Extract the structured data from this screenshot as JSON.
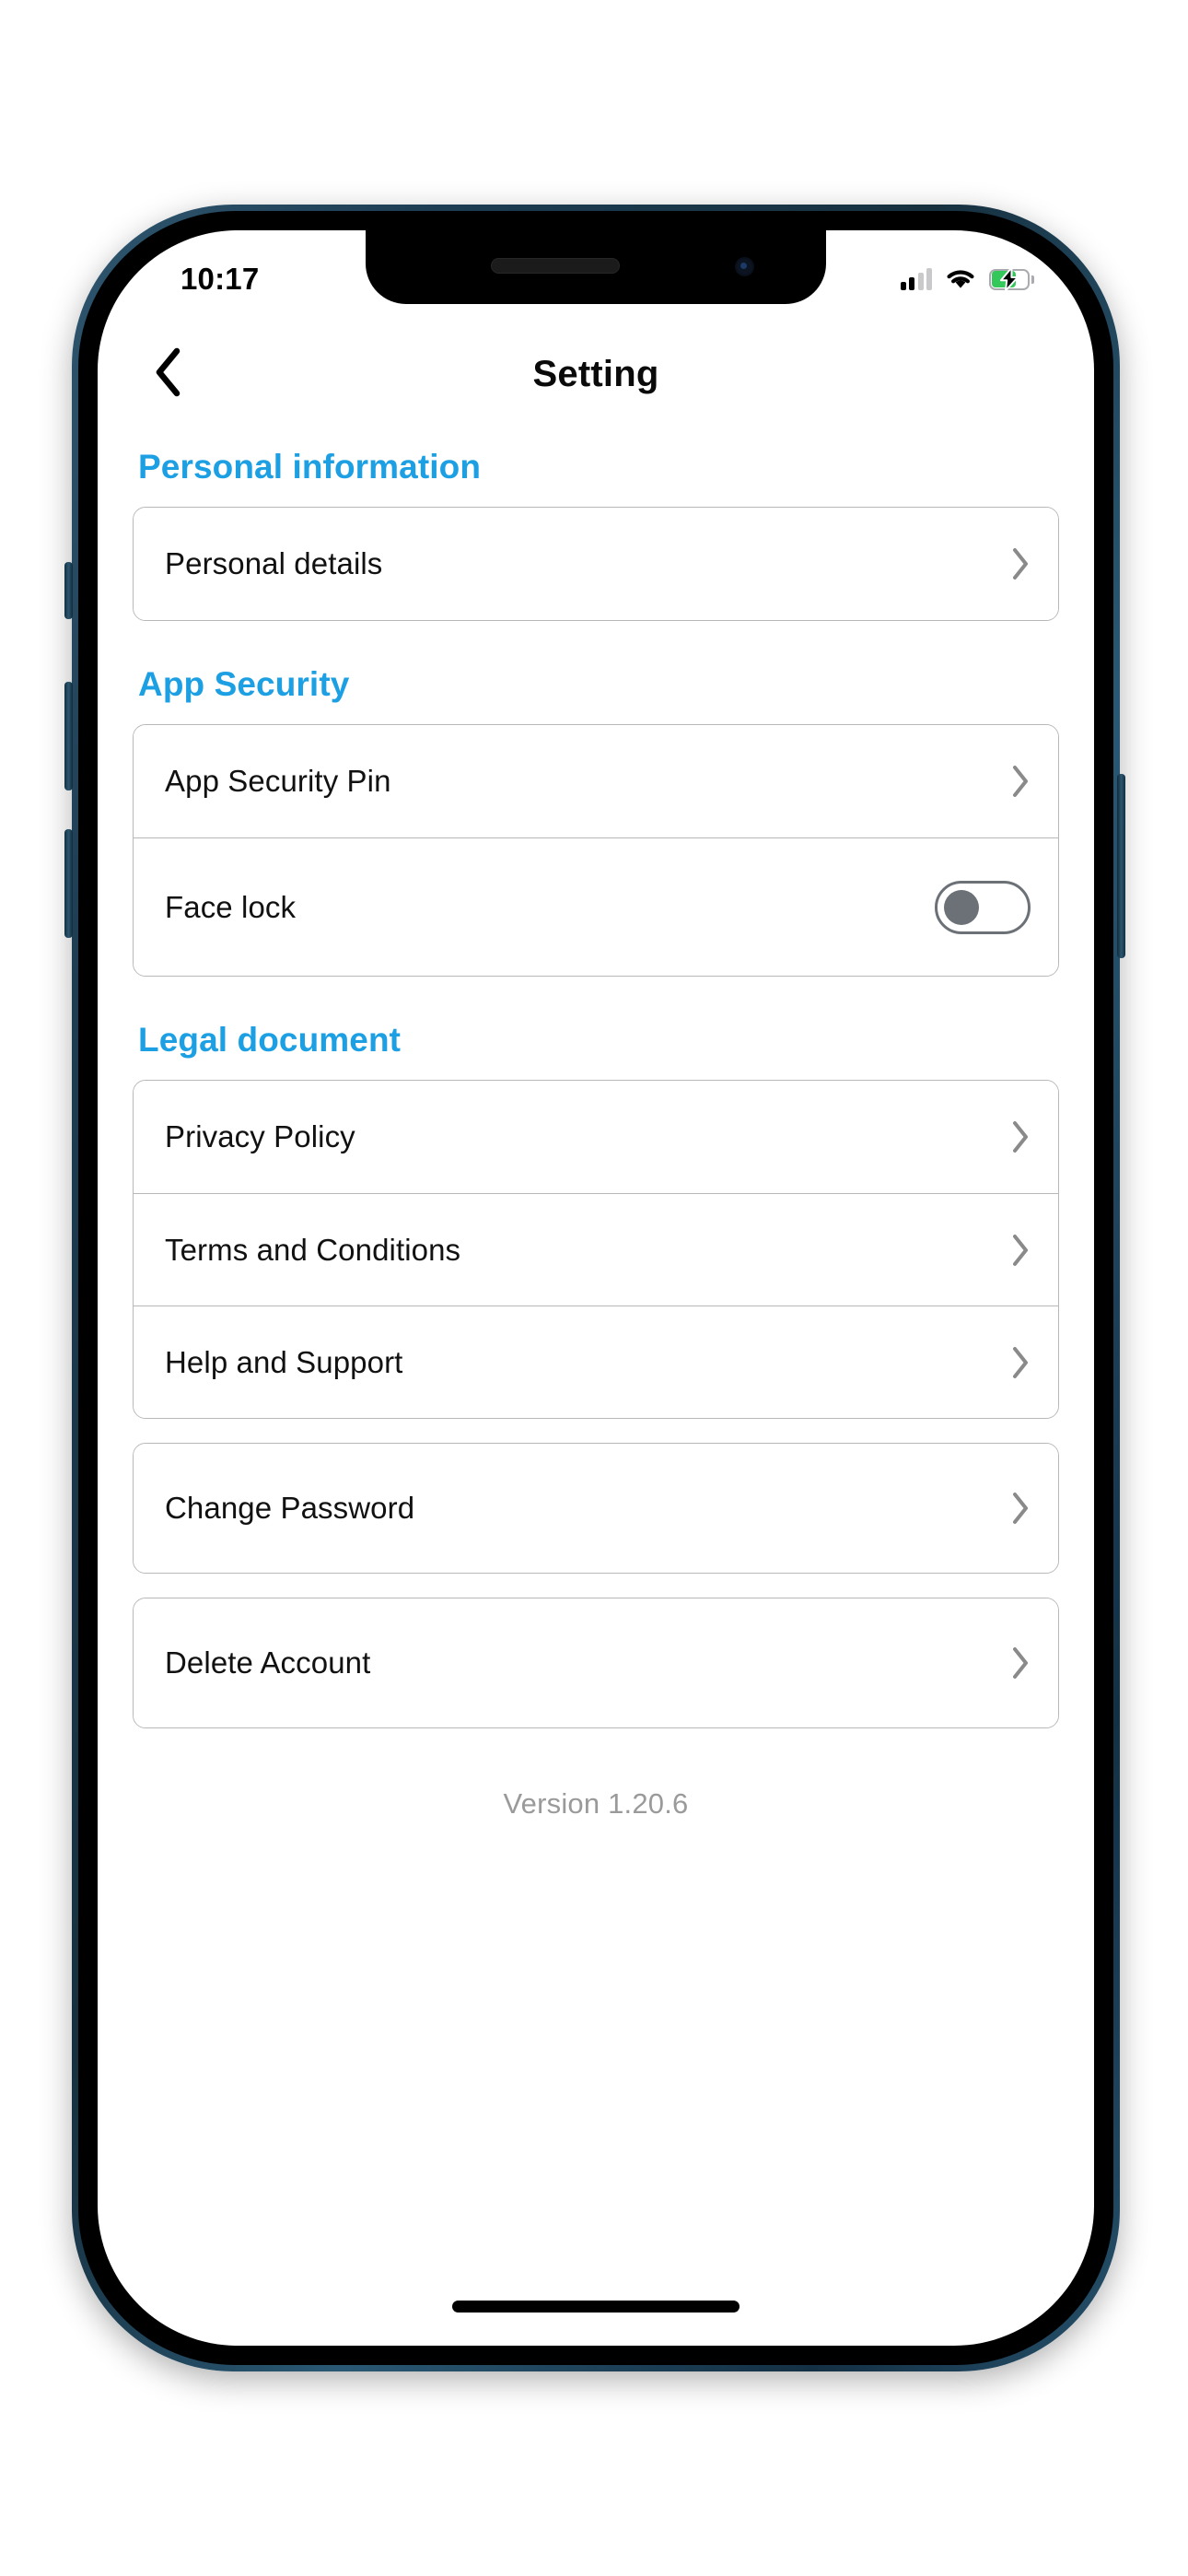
{
  "status_bar": {
    "time": "10:17",
    "signal_icon": "cellular-signal-icon",
    "signal_bars_filled": 2,
    "signal_bars_total": 4,
    "wifi_icon": "wifi-icon",
    "battery_icon": "battery-charging-icon",
    "battery_level_percent": 60,
    "battery_color": "#34c759",
    "charging": true
  },
  "header": {
    "back_icon": "chevron-left-icon",
    "title": "Setting"
  },
  "theme": {
    "accent": "#1CA0E3",
    "text": "#111111",
    "muted": "#9a9a9a",
    "border": "#b8b8b8",
    "background": "#ffffff"
  },
  "sections": [
    {
      "title": "Personal information",
      "cards": [
        {
          "rows": [
            {
              "label": "Personal details",
              "control": "chevron",
              "icon": "chevron-right-icon"
            }
          ]
        }
      ]
    },
    {
      "title": "App Security",
      "cards": [
        {
          "rows": [
            {
              "label": "App Security Pin",
              "control": "chevron",
              "icon": "chevron-right-icon"
            },
            {
              "label": "Face lock",
              "control": "toggle",
              "icon": "toggle-switch-icon",
              "value": "off"
            }
          ]
        }
      ]
    },
    {
      "title": "Legal document",
      "cards": [
        {
          "rows": [
            {
              "label": "Privacy Policy",
              "control": "chevron",
              "icon": "chevron-right-icon"
            },
            {
              "label": "Terms and Conditions",
              "control": "chevron",
              "icon": "chevron-right-icon"
            },
            {
              "label": "Help and Support",
              "control": "chevron",
              "icon": "chevron-right-icon"
            }
          ]
        },
        {
          "rows": [
            {
              "label": "Change Password",
              "control": "chevron",
              "icon": "chevron-right-icon"
            }
          ]
        },
        {
          "rows": [
            {
              "label": "Delete Account",
              "control": "chevron",
              "icon": "chevron-right-icon"
            }
          ]
        }
      ]
    }
  ],
  "footer": {
    "version": "Version 1.20.6"
  }
}
